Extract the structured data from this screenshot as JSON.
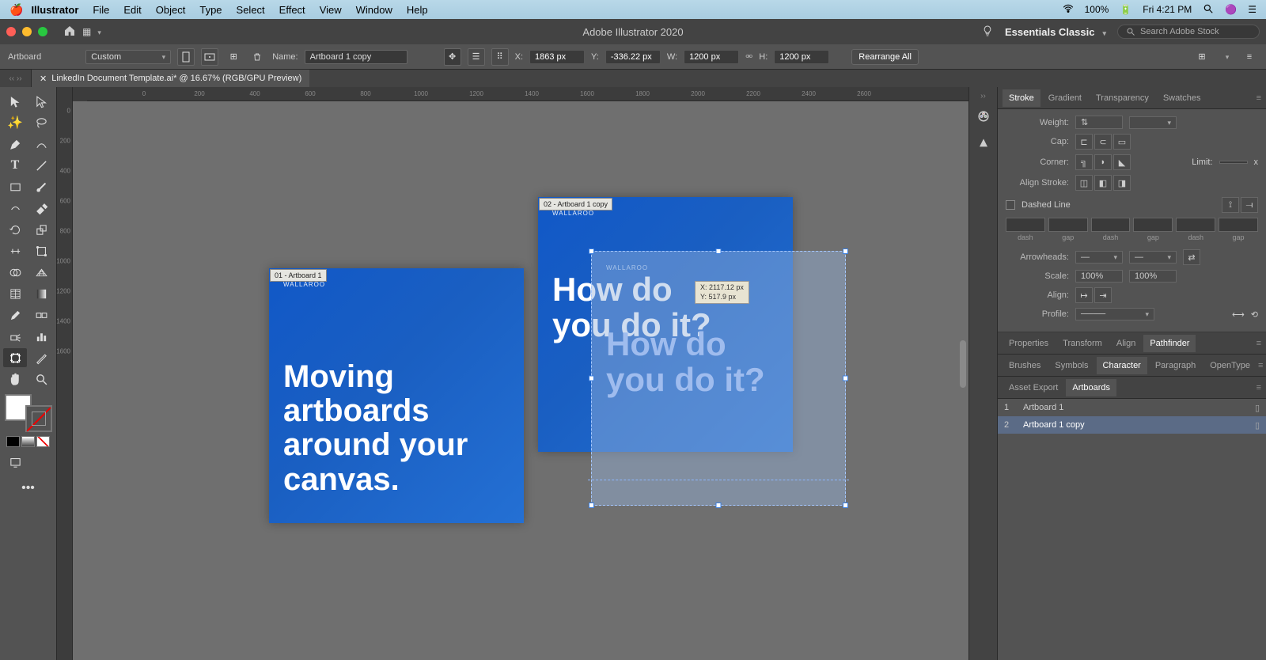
{
  "menubar": {
    "app": "Illustrator",
    "items": [
      "File",
      "Edit",
      "Object",
      "Type",
      "Select",
      "Effect",
      "View",
      "Window",
      "Help"
    ],
    "battery": "100%",
    "clock": "Fri 4:21 PM"
  },
  "appbar": {
    "title": "Adobe Illustrator 2020",
    "workspace": "Essentials Classic",
    "search_placeholder": "Search Adobe Stock"
  },
  "controlbar": {
    "tool_label": "Artboard",
    "preset": "Custom",
    "name_label": "Name:",
    "name_value": "Artboard 1 copy",
    "x_label": "X:",
    "x_value": "1863 px",
    "y_label": "Y:",
    "y_value": "-336.22 px",
    "w_label": "W:",
    "w_value": "1200 px",
    "h_label": "H:",
    "h_value": "1200 px",
    "rearrange": "Rearrange All"
  },
  "tab": {
    "title": "LinkedIn Document Template.ai* @ 16.67% (RGB/GPU Preview)"
  },
  "ruler_h": [
    "0",
    "200",
    "400",
    "600",
    "800",
    "1000",
    "1200",
    "1400",
    "1600",
    "1800",
    "2000",
    "2200",
    "2400",
    "2600"
  ],
  "ruler_v": [
    "0",
    "200",
    "400",
    "600",
    "800",
    "1000",
    "1200",
    "1400",
    "1600"
  ],
  "artboards": {
    "ab1": {
      "label": "01 - Artboard 1",
      "brand": "WALLAROO",
      "line1": "Moving",
      "line2": "artboards",
      "line3": "around your",
      "line4": "canvas."
    },
    "ab2": {
      "label": "02 - Artboard 1 copy",
      "brand": "WALLAROO",
      "line1": "How do",
      "line2": "you do it?"
    },
    "ghost": {
      "brand": "WALLAROO",
      "line1": "How do",
      "line2": "you do it?"
    },
    "tooltip_x": "X: 2117.12 px",
    "tooltip_y": "Y: 517.9 px"
  },
  "panels": {
    "tabs1": [
      "Stroke",
      "Gradient",
      "Transparency",
      "Swatches"
    ],
    "stroke": {
      "weight": "Weight:",
      "cap": "Cap:",
      "corner": "Corner:",
      "limit": "Limit:",
      "limit_suffix": "x",
      "align": "Align Stroke:",
      "dashed": "Dashed Line",
      "dash_labels": [
        "dash",
        "gap",
        "dash",
        "gap",
        "dash",
        "gap"
      ],
      "arrowheads": "Arrowheads:",
      "scale": "Scale:",
      "scale_val": "100%",
      "align2": "Align:",
      "profile": "Profile:"
    },
    "tabs2": [
      "Properties",
      "Transform",
      "Align",
      "Pathfinder"
    ],
    "tabs3": [
      "Brushes",
      "Symbols",
      "Character",
      "Paragraph",
      "OpenType"
    ],
    "tabs4": [
      "Asset Export",
      "Artboards"
    ],
    "artboards_list": [
      {
        "num": "1",
        "name": "Artboard 1"
      },
      {
        "num": "2",
        "name": "Artboard 1 copy"
      }
    ]
  }
}
